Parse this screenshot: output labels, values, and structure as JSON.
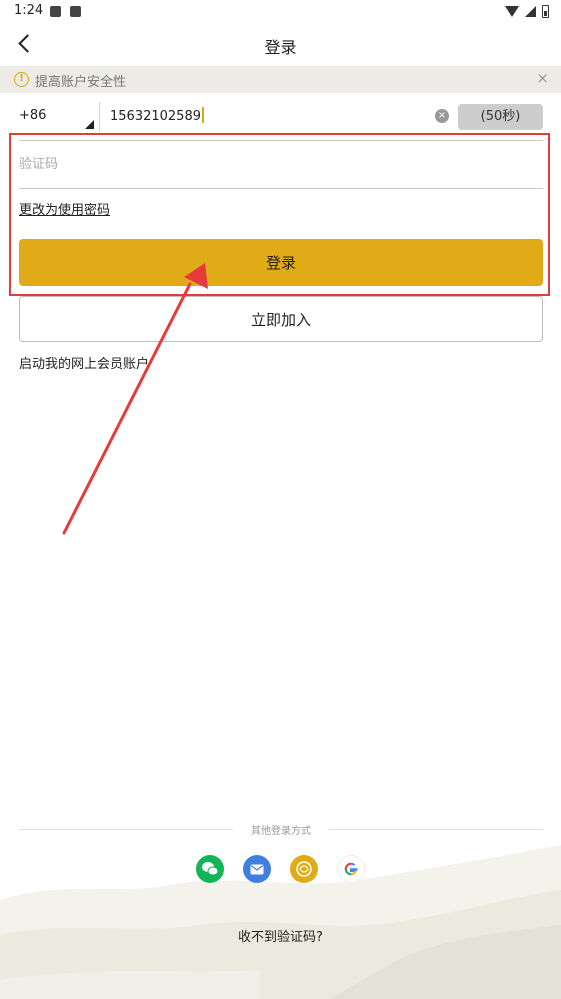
{
  "status_bar": {
    "time": "1:24",
    "left_icons": [
      "image-icon",
      "a-icon"
    ],
    "right_icons": [
      "wifi-icon",
      "signal-icon",
      "battery-icon"
    ]
  },
  "header": {
    "title": "登录",
    "back_icon": "back-arrow-icon"
  },
  "notice": {
    "text": "提高账户安全性",
    "icon": "info-icon",
    "close": "×"
  },
  "phone_row": {
    "country_code": "+86",
    "phone_number": "15632102589",
    "clear_icon": "clear-icon",
    "countdown": "(50秒)"
  },
  "verify": {
    "placeholder": "验证码",
    "switch_link": "更改为使用密码"
  },
  "buttons": {
    "login": "登录",
    "join": "立即加入"
  },
  "activate_link": "启动我的网上会员账户",
  "other_login": {
    "label": "其他登录方式",
    "methods": [
      "wechat-icon",
      "mail-icon",
      "member-icon",
      "google-icon"
    ]
  },
  "no_code_link": "收不到验证码?",
  "colors": {
    "accent": "#dfab17",
    "highlight": "#e63b3b",
    "wechat": "#14b45a",
    "mail": "#3e7fe0"
  }
}
